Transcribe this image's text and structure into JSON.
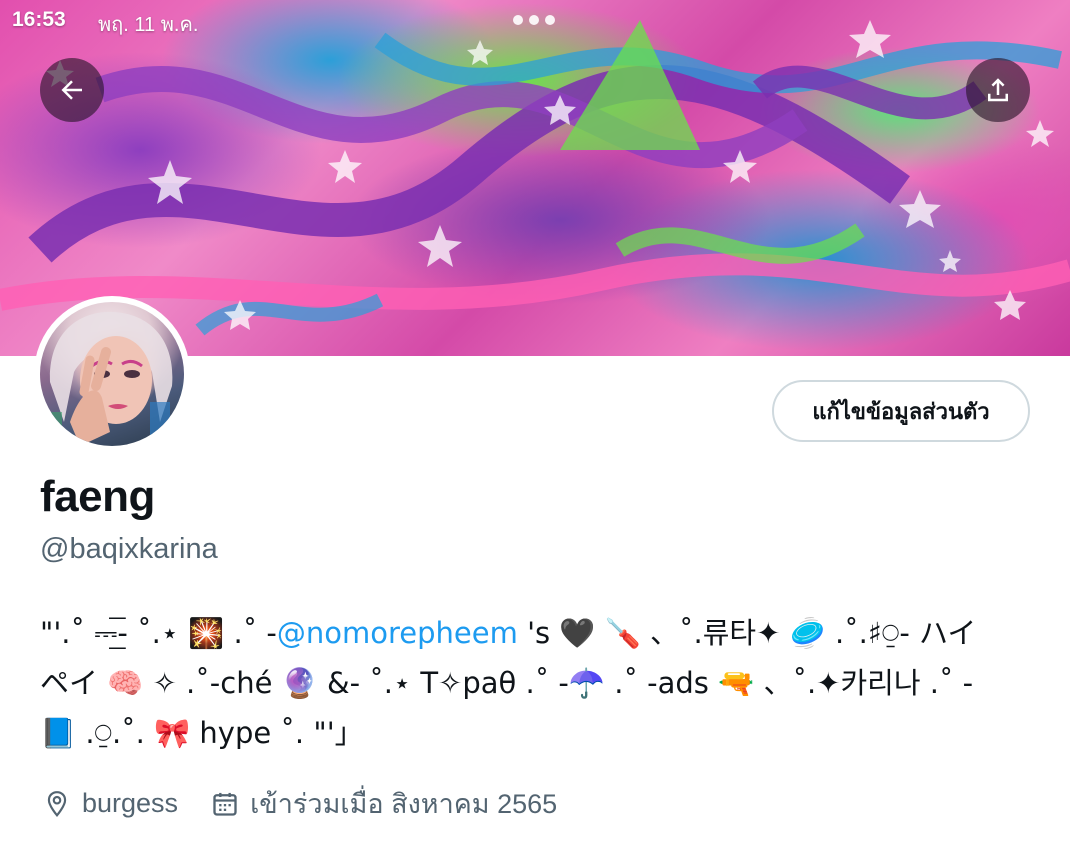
{
  "status_bar": {
    "time": "16:53",
    "date": "พฤ. 11 พ.ค."
  },
  "header": {
    "back_icon": "arrow-left-icon",
    "share_icon": "share-upload-icon"
  },
  "profile": {
    "edit_label": "แก้ไขข้อมูลส่วนตัว",
    "display_name": "faeng",
    "handle": "@baqixkarina",
    "bio": {
      "line1_pre": "\"'.˚ ⎓͟͟͞͞- ˚.⋆ 🎇 .˚ -",
      "mention": "@nomorepheem",
      "line1_post": " 's 🖤 🪛 、˚.류타✦ 🥏 .˚.♯⍜- ハイ",
      "line2": "ペイ 🧠 ✧ .˚-ché 🔮 &- ˚.⋆ T✧paθ .˚ -☂️ .˚ -ads 🔫 、˚.✦카리나 .˚ -",
      "line3": "📘 .⍜.˚. 🎀 hype ˚. \"'」"
    },
    "location": "burgess",
    "joined": "เข้าร่วมเมื่อ สิงหาคม 2565"
  },
  "icons": {
    "location": "location-pin-icon",
    "calendar": "calendar-icon"
  },
  "colors": {
    "mention": "#1d9bf0",
    "secondary_text": "#536471",
    "border": "#cfd9de"
  }
}
